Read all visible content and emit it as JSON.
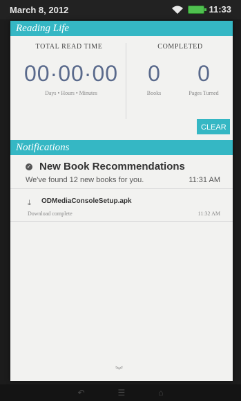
{
  "status_bar": {
    "date": "March 8, 2012",
    "time": "11:33"
  },
  "reading_life": {
    "header": "Reading Life",
    "total_read_time_title": "TOTAL READ TIME",
    "completed_title": "COMPLETED",
    "time_value": "00·00·00",
    "time_units": "Days • Hours • Minutes",
    "books_value": "0",
    "books_label": "Books",
    "pages_value": "0",
    "pages_label": "Pages Turned",
    "clear_label": "CLEAR"
  },
  "notifications": {
    "header": "Notifications",
    "items": [
      {
        "title": "New Book Recommendations",
        "subtitle": "We've found 12 new books for you.",
        "time": "11:31 AM"
      },
      {
        "title": "ODMediaConsoleSetup.apk",
        "subtitle": "Download complete",
        "time": "11:32 AM"
      }
    ]
  },
  "colors": {
    "accent": "#35b7c4",
    "number": "#5a6a8c"
  }
}
